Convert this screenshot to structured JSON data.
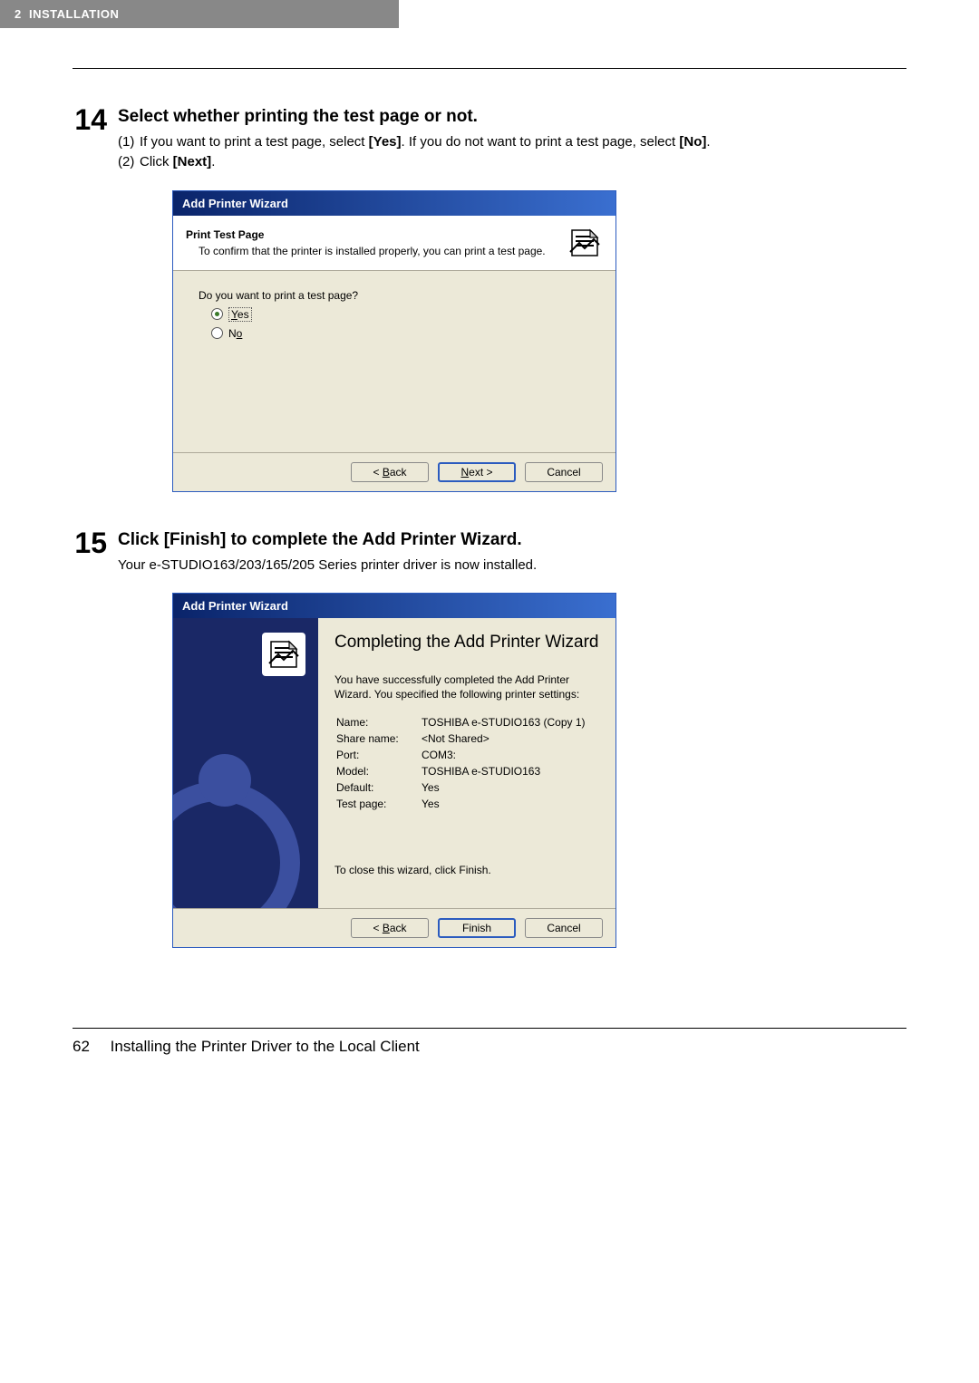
{
  "header": {
    "chapter_num": "2",
    "chapter_title": "INSTALLATION"
  },
  "steps": [
    {
      "num": "14",
      "title": "Select whether printing the test page or not.",
      "lines": [
        {
          "n": "(1)",
          "pre": "If you want to print a test page, select ",
          "b1": "[Yes]",
          "mid": ". If you do not want to print a test page, select ",
          "b2": "[No]",
          "post": "."
        },
        {
          "n": "(2)",
          "pre": "Click ",
          "b1": "[Next]",
          "mid": "",
          "b2": "",
          "post": "."
        }
      ],
      "dialog": {
        "title": "Add Printer Wizard",
        "header_title": "Print Test Page",
        "header_sub": "To confirm that the printer is installed properly, you can print a test page.",
        "question": "Do you want to print a test page?",
        "opt_yes_char": "Y",
        "opt_yes_rest": "es",
        "opt_no_rest": "N",
        "opt_no_char": "o",
        "back_u": "B",
        "back_rest": "ack",
        "back_pre": "< ",
        "next_u": "N",
        "next_rest": "ext >",
        "cancel": "Cancel"
      }
    },
    {
      "num": "15",
      "title": "Click [Finish] to complete the Add Printer Wizard.",
      "sub": "Your e-STUDIO163/203/165/205 Series printer driver is now installed.",
      "dialog": {
        "title": "Add Printer Wizard",
        "h1": "Completing the Add Printer Wizard",
        "p": "You have successfully completed the Add Printer Wizard. You specified the following printer settings:",
        "rows": [
          {
            "k": "Name:",
            "v": "TOSHIBA e-STUDIO163 (Copy 1)"
          },
          {
            "k": "Share name:",
            "v": "<Not Shared>"
          },
          {
            "k": "Port:",
            "v": "COM3:"
          },
          {
            "k": "Model:",
            "v": "TOSHIBA e-STUDIO163"
          },
          {
            "k": "Default:",
            "v": "Yes"
          },
          {
            "k": "Test page:",
            "v": "Yes"
          }
        ],
        "close": "To close this wizard, click Finish.",
        "back_u": "B",
        "back_rest": "ack",
        "back_pre": "< ",
        "finish": "Finish",
        "cancel": "Cancel"
      }
    }
  ],
  "footer": {
    "page": "62",
    "text": "Installing the Printer Driver to the Local Client"
  }
}
